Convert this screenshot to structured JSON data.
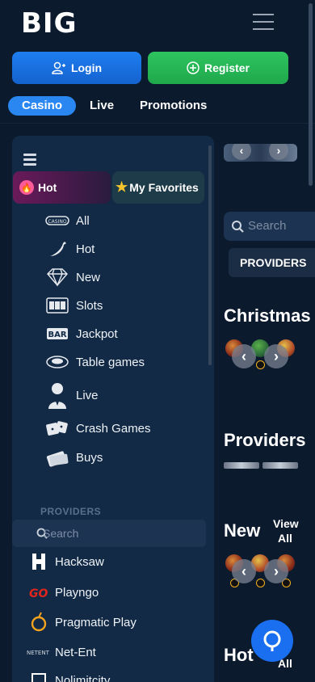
{
  "header": {
    "logo": "BIG",
    "menu_icon": "hamburger-icon"
  },
  "auth": {
    "login_label": "Login",
    "register_label": "Register"
  },
  "tabs": [
    {
      "label": "Casino",
      "active": true
    },
    {
      "label": "Live",
      "active": false
    },
    {
      "label": "Promotions",
      "active": false
    }
  ],
  "sidebar": {
    "hot_tab": "Hot",
    "favorites_tab": "My Favorites",
    "categories": [
      {
        "label": "All",
        "icon": "casino-icon"
      },
      {
        "label": "Hot",
        "icon": "chili-icon"
      },
      {
        "label": "New",
        "icon": "diamond-icon"
      },
      {
        "label": "Slots",
        "icon": "slot-machine-icon"
      },
      {
        "label": "Jackpot",
        "icon": "bar-icon"
      },
      {
        "label": "Table games",
        "icon": "roulette-icon"
      },
      {
        "label": "Live",
        "icon": "dealer-icon"
      },
      {
        "label": "Crash Games",
        "icon": "dice-icon"
      },
      {
        "label": "Buys",
        "icon": "cash-icon"
      }
    ],
    "providers_header": "PROVIDERS",
    "providers_search_placeholder": "Search",
    "providers": [
      {
        "label": "Hacksaw",
        "icon": "hacksaw-logo-icon"
      },
      {
        "label": "Playngo",
        "icon": "playngo-logo-icon"
      },
      {
        "label": "Pragmatic Play",
        "icon": "pragmatic-logo-icon"
      },
      {
        "label": "Net-Ent",
        "icon": "netent-logo-icon"
      },
      {
        "label": "Nolimitcity",
        "icon": "nolimitcity-logo-icon"
      }
    ]
  },
  "main": {
    "search_placeholder": "Search",
    "providers_button": "PROVIDERS",
    "sections": [
      {
        "title": "Christmas"
      },
      {
        "title": "Providers"
      },
      {
        "title": "New",
        "view_all": "View All"
      },
      {
        "title": "Hot",
        "view_all": "All"
      }
    ]
  },
  "colors": {
    "background": "#0c1a2e",
    "sidebar": "#122a45",
    "login": "#1e7ef0",
    "register": "#2ec45f",
    "active_tab": "#2a86f0",
    "chat": "#1a6ff0"
  }
}
